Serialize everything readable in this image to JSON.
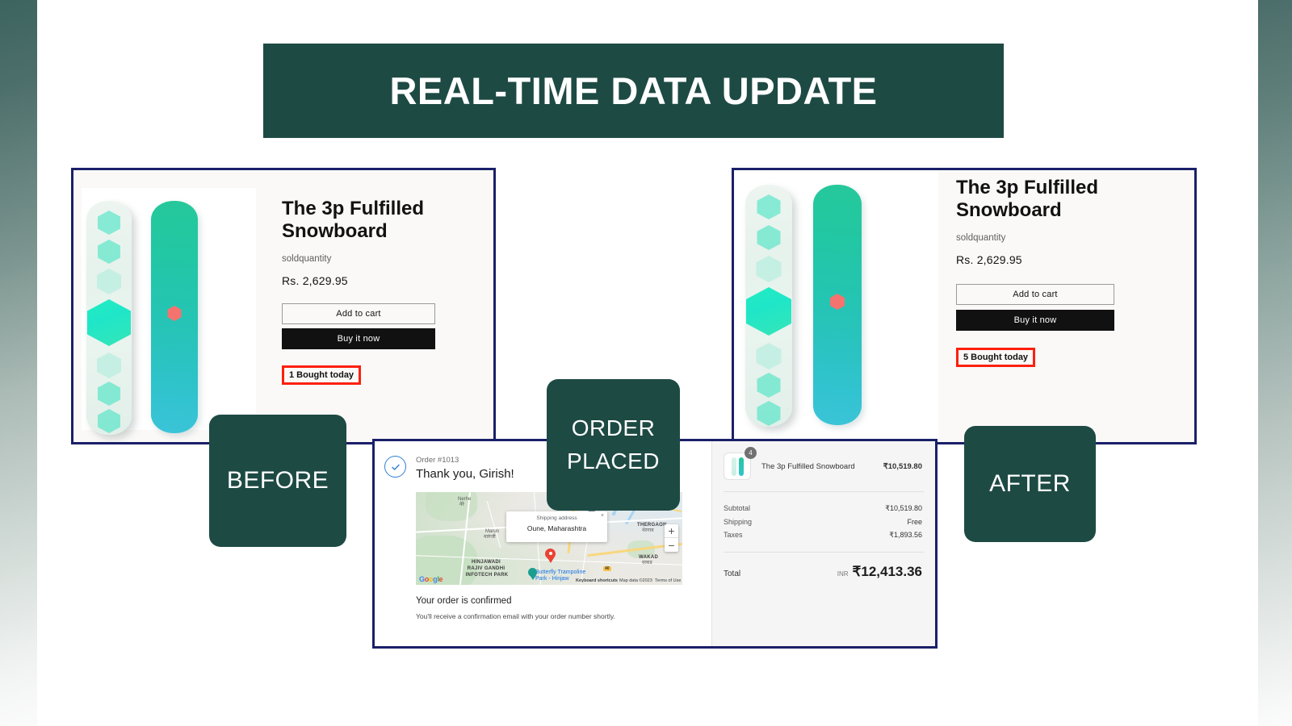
{
  "title": {
    "text": "REAL-TIME DATA UPDATE"
  },
  "callouts": {
    "before": "BEFORE",
    "order_line1": "ORDER",
    "order_line2": "PLACED",
    "after": "AFTER"
  },
  "product": {
    "name": "The 3p Fulfilled Snowboard",
    "sold_label": "soldquantity",
    "price": "Rs. 2,629.95",
    "add_to_cart_label": "Add to cart",
    "buy_now_label": "Buy it now",
    "sold_before": "1 Bought today",
    "sold_after": "5 Bought today"
  },
  "order": {
    "order_number": "Order #1013",
    "thanks": "Thank you, Girish!",
    "confirmed_title": "Your order is confirmed",
    "confirmed_sub": "You'll receive a confirmation email with your order number shortly.",
    "map": {
      "popup_title": "Shipping address",
      "popup_address": "Oune, Maharashtra",
      "close_glyph": "×",
      "zoom_in": "+",
      "zoom_out": "−",
      "labels": [
        "Nerhe",
        "नेरे",
        "Marun",
        "मारुंजी",
        "HINJAWADI",
        "RAJIV GANDHI",
        "INFOTECH PARK",
        "THERGAON",
        "थेरगाव",
        "WAKAD",
        "वाकड",
        "Butterfly Trampoline",
        "Park - Hinjaw"
      ],
      "google_letters": [
        "G",
        "o",
        "o",
        "g",
        "l",
        "e"
      ],
      "keyboard_shortcuts": "Keyboard shortcuts",
      "map_data": "Map data ©2023",
      "terms": "Terms of Use",
      "highway_badge": "40"
    },
    "summary": {
      "item_name": "The 3p Fulfilled Snowboard",
      "item_qty": "4",
      "item_price": "₹10,519.80",
      "lines": [
        {
          "label": "Subtotal",
          "value": "₹10,519.80"
        },
        {
          "label": "Shipping",
          "value": "Free"
        },
        {
          "label": "Taxes",
          "value": "₹1,893.56"
        }
      ],
      "total_label": "Total",
      "total_currency": "INR",
      "total_value": "₹12,413.36"
    }
  },
  "colors": {
    "banner_green": "#1e4a44",
    "panel_border_navy": "#1a2068",
    "highlight_red": "#fe1f0d",
    "board_teal": "#24c5b1",
    "accent_coral": "#f4736e"
  }
}
